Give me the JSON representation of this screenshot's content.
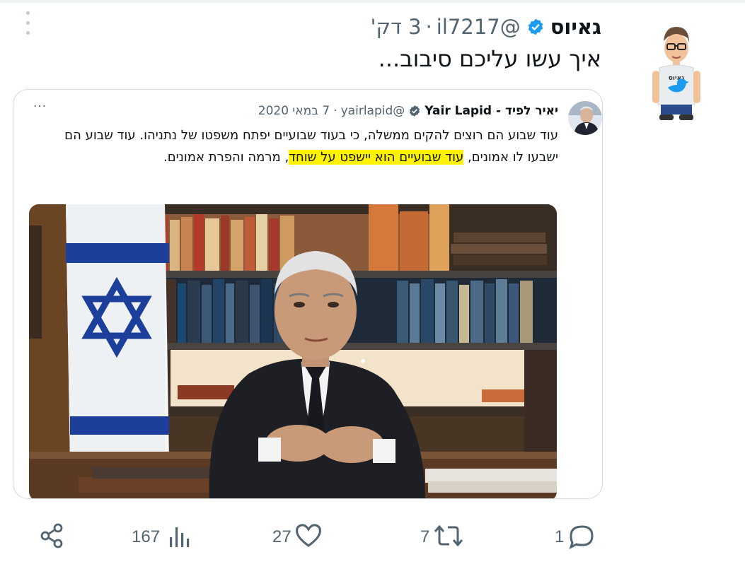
{
  "tweet": {
    "author": "גאיוס",
    "handle": "@il7217",
    "separator": "·",
    "time": "3 דק'",
    "text": "איך עשו עליכם סיבוב...",
    "avatar_text": "גאיוס"
  },
  "quoted": {
    "name": "יאיר לפיד - Yair Lapid",
    "handle": "@yairlapid",
    "separator": "·",
    "date": "7 במאי 2020",
    "more": "···",
    "text_part1": "עוד שבוע הם רוצים להקים ממשלה, כי בעוד שבועיים יפתח משפטו של נתניהו. עוד שבוע הם ישבעו לו אמונים, ",
    "text_highlight": "עוד שבועיים הוא יישפט על שוחד",
    "text_part2": ", מרמה והפרת אמונים."
  },
  "actions": {
    "reply_count": "1",
    "retweet_count": "7",
    "like_count": "27",
    "views_count": "167"
  },
  "colors": {
    "text": "#0f1419",
    "secondary": "#536471",
    "verified": "#1d9bf0",
    "highlight": "#fff200",
    "border": "#cfd9de"
  }
}
